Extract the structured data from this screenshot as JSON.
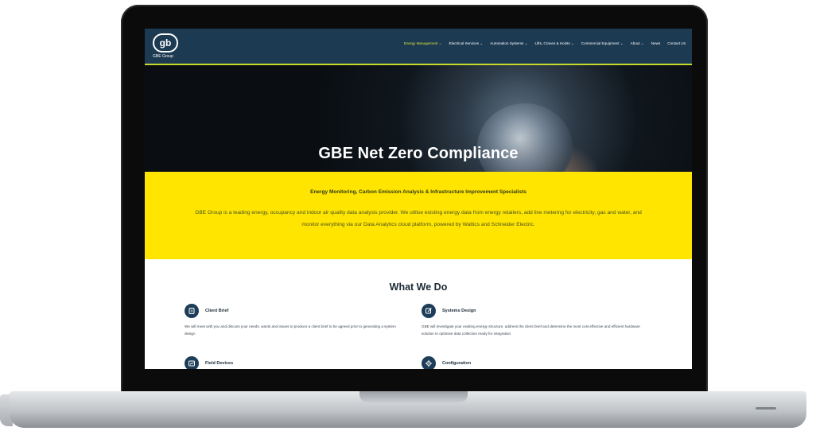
{
  "logo": {
    "mark": "gb",
    "text": "GBE Group"
  },
  "nav": [
    {
      "label": "Energy Management ⌄",
      "active": true
    },
    {
      "label": "Electrical Services ⌄",
      "active": false
    },
    {
      "label": "Automation Systems ⌄",
      "active": false
    },
    {
      "label": "Lifts, Cranes & Hoists ⌄",
      "active": false
    },
    {
      "label": "Commercial Equipment ⌄",
      "active": false
    },
    {
      "label": "About ⌄",
      "active": false
    },
    {
      "label": "News",
      "active": false
    },
    {
      "label": "Contact Us",
      "active": false
    }
  ],
  "hero": {
    "title": "GBE Net Zero Compliance"
  },
  "intro": {
    "heading": "Energy Monitoring, Carbon Emission Analysis & Infrastructure Improvement Specialists",
    "body": "GBE Group is a leading energy, occupancy and indoor air quality data analysis provider. We utilise existing energy data from energy retailers, add live metering for electricity, gas and water, and monitor everything via our Data Analytics cloud platform, powered by Wattics and Schneider Electric."
  },
  "what_we_do": {
    "title": "What We Do",
    "services": [
      {
        "title": "Client Brief",
        "icon": "document-icon",
        "desc": "We will meet with you and discuss your needs, wants and issues to produce a client brief to be agreed prior to generating a system design"
      },
      {
        "title": "Systems Design",
        "icon": "edit-icon",
        "desc": "GBE will investigate your existing energy structure, address the client brief and determine the most cost effective and efficient hardware solution to optimise data collection ready for integration"
      },
      {
        "title": "Field Devices",
        "icon": "chart-icon",
        "desc": ""
      },
      {
        "title": "Configuration",
        "icon": "gear-icon",
        "desc": ""
      }
    ]
  },
  "colors": {
    "nav_bg": "#1c3a52",
    "accent": "#ffe500",
    "active_nav": "#d6e43a",
    "icon_bg": "#1d3d58"
  }
}
